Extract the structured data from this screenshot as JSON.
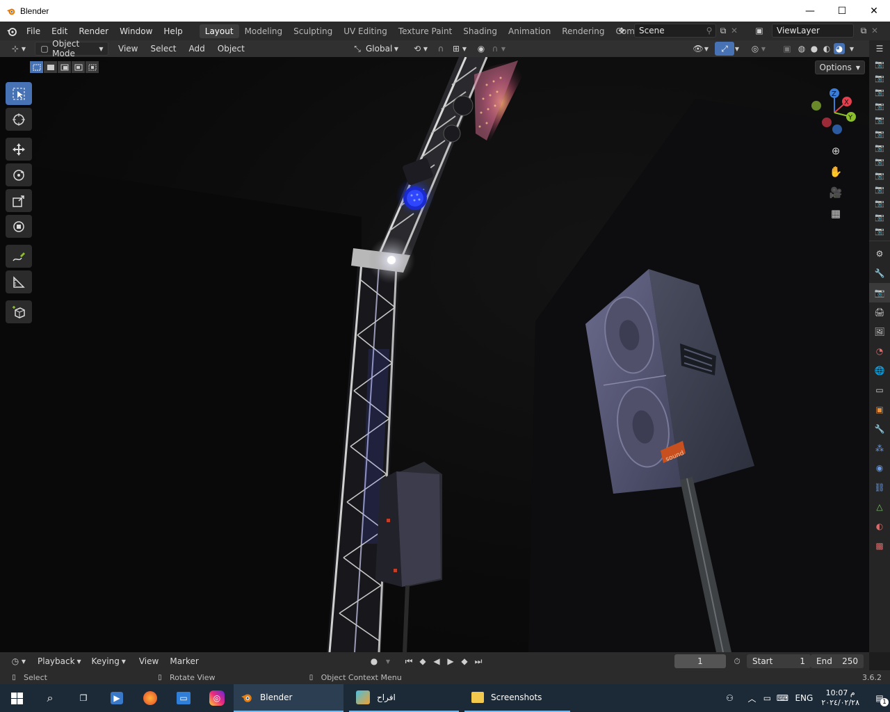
{
  "window": {
    "title": "Blender",
    "controls": {
      "minimize": "—",
      "maximize": "☐",
      "close": "✕"
    }
  },
  "menu": {
    "items": [
      "File",
      "Edit",
      "Render",
      "Window",
      "Help"
    ]
  },
  "workspaces": {
    "tabs": [
      "Layout",
      "Modeling",
      "Sculpting",
      "UV Editing",
      "Texture Paint",
      "Shading",
      "Animation",
      "Rendering",
      "Compositing"
    ],
    "active": "Layout"
  },
  "scene": {
    "name": "Scene"
  },
  "view_layer": {
    "name": "ViewLayer"
  },
  "header": {
    "mode": "Object Mode",
    "menus": [
      "View",
      "Select",
      "Add",
      "Object"
    ],
    "transform_orientation": "Global"
  },
  "viewport": {
    "options_label": "Options",
    "gizmo_axes": {
      "x": "X",
      "y": "Y",
      "z": "Z"
    },
    "speaker_label": "sound"
  },
  "timeline": {
    "menus": [
      "Playback",
      "Keying",
      "View",
      "Marker"
    ],
    "current_frame": "1",
    "start_label": "Start",
    "start_value": "1",
    "end_label": "End",
    "end_value": "250"
  },
  "status": {
    "select": "Select",
    "rotate": "Rotate View",
    "context": "Object Context Menu",
    "version": "3.6.2"
  },
  "taskbar": {
    "apps": [
      {
        "label": "Blender",
        "state": "active"
      },
      {
        "label": "افراح",
        "state": "open"
      },
      {
        "label": "Screenshots",
        "state": "open"
      }
    ],
    "lang": "ENG",
    "time": "10:07 م",
    "date": "٢٠٢٤/٠٢/٢٨",
    "notification_count": "1"
  },
  "colors": {
    "accent": "#4772b3",
    "axis_x": "#e3404f",
    "axis_y": "#8bbf2b",
    "axis_z": "#3b7dd6"
  }
}
